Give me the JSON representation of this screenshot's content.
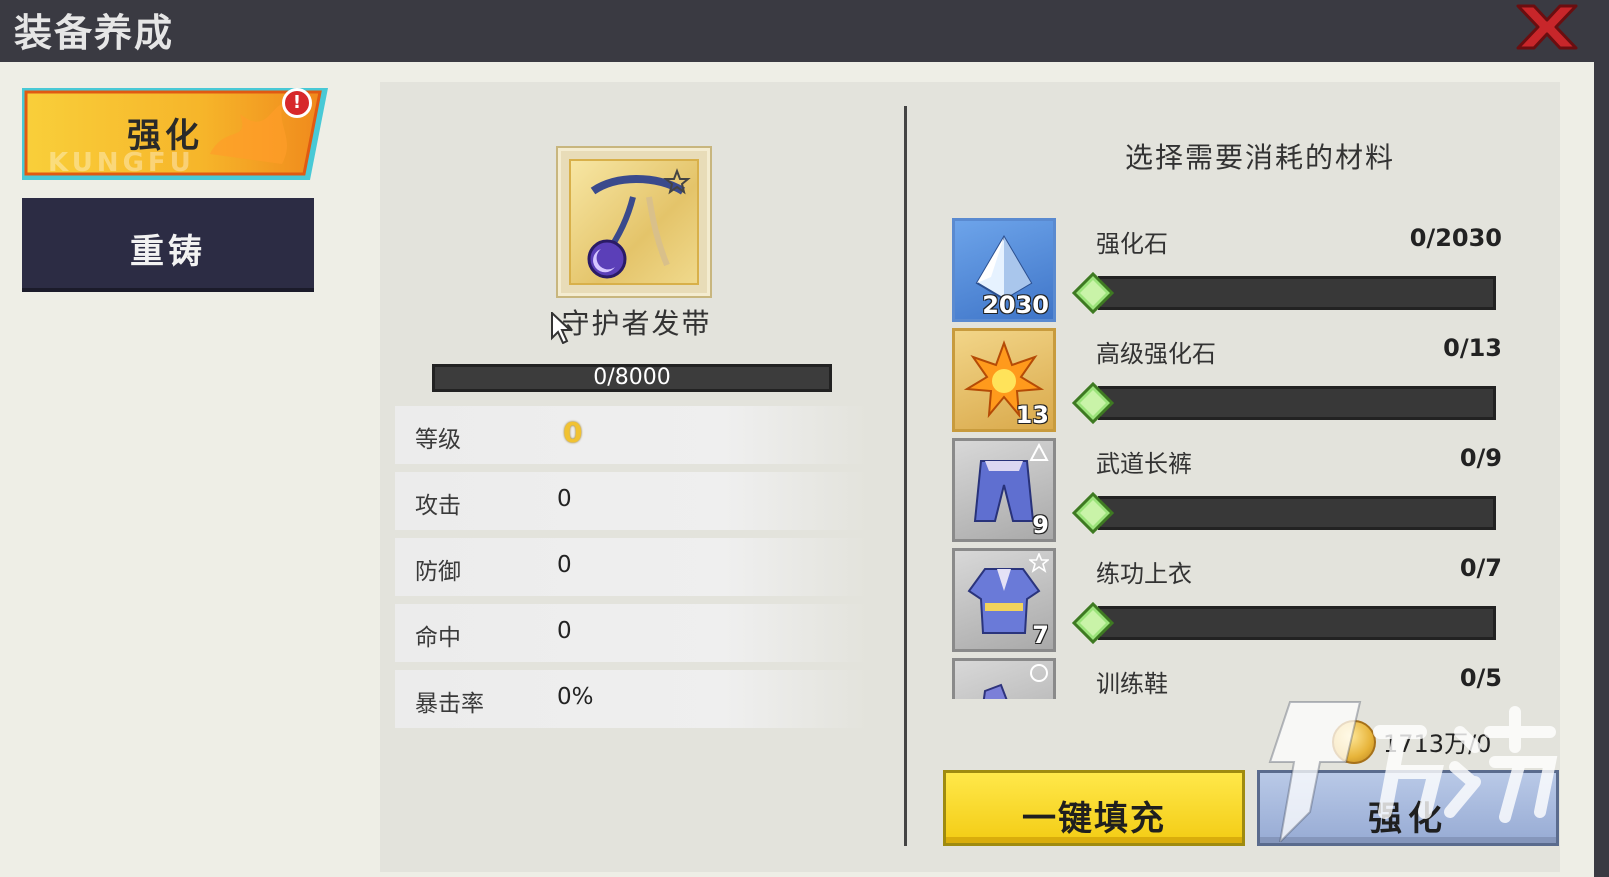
{
  "header": {
    "title": "装备养成"
  },
  "tabs": [
    {
      "label": "强化",
      "watermark": "KUNGFU",
      "active": true,
      "alert": "!"
    },
    {
      "label": "重铸",
      "active": false
    }
  ],
  "equipment": {
    "name": "守护者发带",
    "exp": "0/8000",
    "exp_fraction": 0,
    "stats": [
      {
        "label": "等级",
        "value": "0"
      },
      {
        "label": "攻击",
        "value": "0"
      },
      {
        "label": "防御",
        "value": "0"
      },
      {
        "label": "命中",
        "value": "0"
      },
      {
        "label": "暴击率",
        "value": "0%"
      }
    ]
  },
  "materials": {
    "title": "选择需要消耗的材料",
    "items": [
      {
        "name": "强化石",
        "count": "2030",
        "progress": "0/2030",
        "icon": "crystal-icon"
      },
      {
        "name": "高级强化石",
        "count": "13",
        "progress": "0/13",
        "icon": "star-burst-icon"
      },
      {
        "name": "武道长裤",
        "count": "9",
        "progress": "0/9",
        "icon": "pants-icon"
      },
      {
        "name": "练功上衣",
        "count": "7",
        "progress": "0/7",
        "icon": "robe-icon"
      },
      {
        "name": "训练鞋",
        "count": "",
        "progress": "0/5",
        "icon": "shoes-icon"
      }
    ]
  },
  "currency": {
    "value": "1713万/0",
    "icon": "gold-coin-icon"
  },
  "buttons": {
    "fill": "一键填充",
    "enhance": "强化"
  },
  "colors": {
    "accent_yellow": "#f3cc14",
    "tab_dark": "#2c2c44",
    "title_bar": "#3a3a42",
    "close_red": "#c8262a"
  }
}
